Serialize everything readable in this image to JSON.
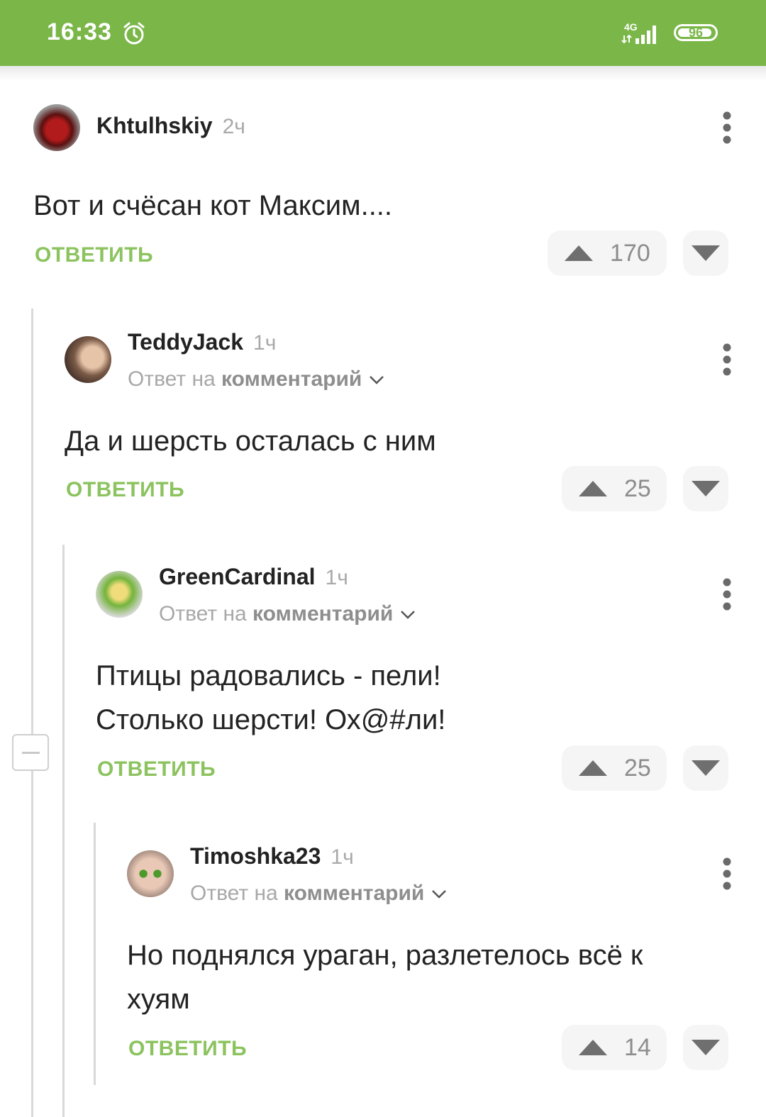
{
  "status_bar": {
    "time": "16:33",
    "network": "4G",
    "battery": "96",
    "colors": {
      "bar": "#7ab648"
    }
  },
  "ui": {
    "reply_prefix": "Ответ на",
    "reply_target": "комментарий",
    "reply_button": "ОТВЕТИТЬ"
  },
  "icons": {
    "alarm": "alarm-clock-icon",
    "signal": "signal-icon",
    "more": "more-vertical-icon",
    "upvote": "upvote-icon",
    "downvote": "downvote-icon",
    "collapse": "collapse-icon"
  },
  "comments": [
    {
      "author": "Khtulhskiy",
      "time": "2ч",
      "text": "Вот и счёсан кот Максим....",
      "rating": "170"
    },
    {
      "author": "TeddyJack",
      "time": "1ч",
      "text": "Да и шерсть осталась с ним",
      "rating": "25"
    },
    {
      "author": "GreenCardinal",
      "time": "1ч",
      "text_lines": [
        "Птицы радовались - пели!",
        "Столько шерсти! Ох@#ли!"
      ],
      "rating": "25"
    },
    {
      "author": "Timoshka23",
      "time": "1ч",
      "text_lines": [
        "Но поднялся ураган, разлетелось всё к",
        "хуям"
      ],
      "rating": "14"
    }
  ],
  "colors": {
    "accent_green": "#8cc35f",
    "status_bar_green": "#7ab648"
  }
}
